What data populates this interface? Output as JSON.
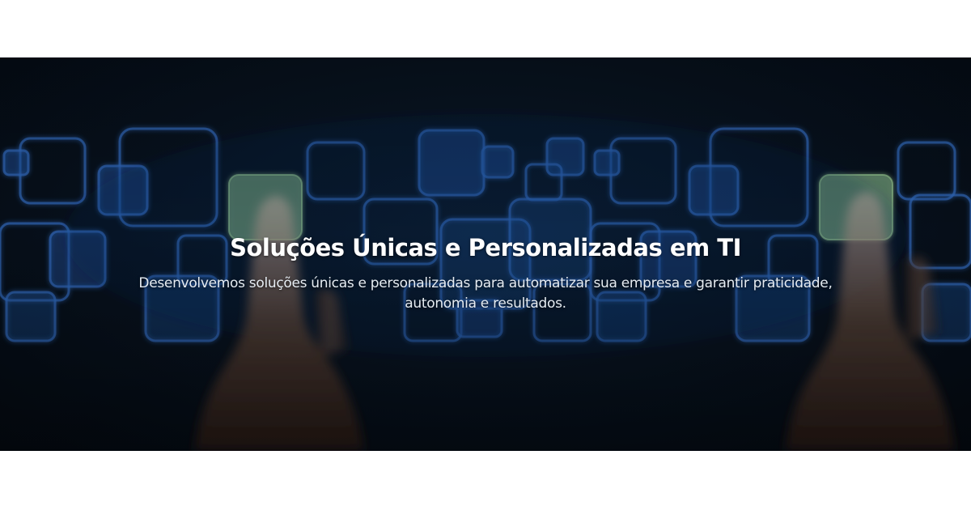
{
  "hero": {
    "title": "Soluções Únicas e Personalizadas em TI",
    "subtitle": "Desenvolvemos soluções únicas e personalizadas para automatizar sua empresa e garantir praticidade, autonomia e resultados.",
    "background_image": "glowing-squares-touch-fingers"
  },
  "colors": {
    "page_background": "#ffffff",
    "hero_background": "#07111d",
    "square_glow": "#3d7bd8",
    "square_highlight": "#8fbf8a",
    "title_text": "#ffffff"
  }
}
